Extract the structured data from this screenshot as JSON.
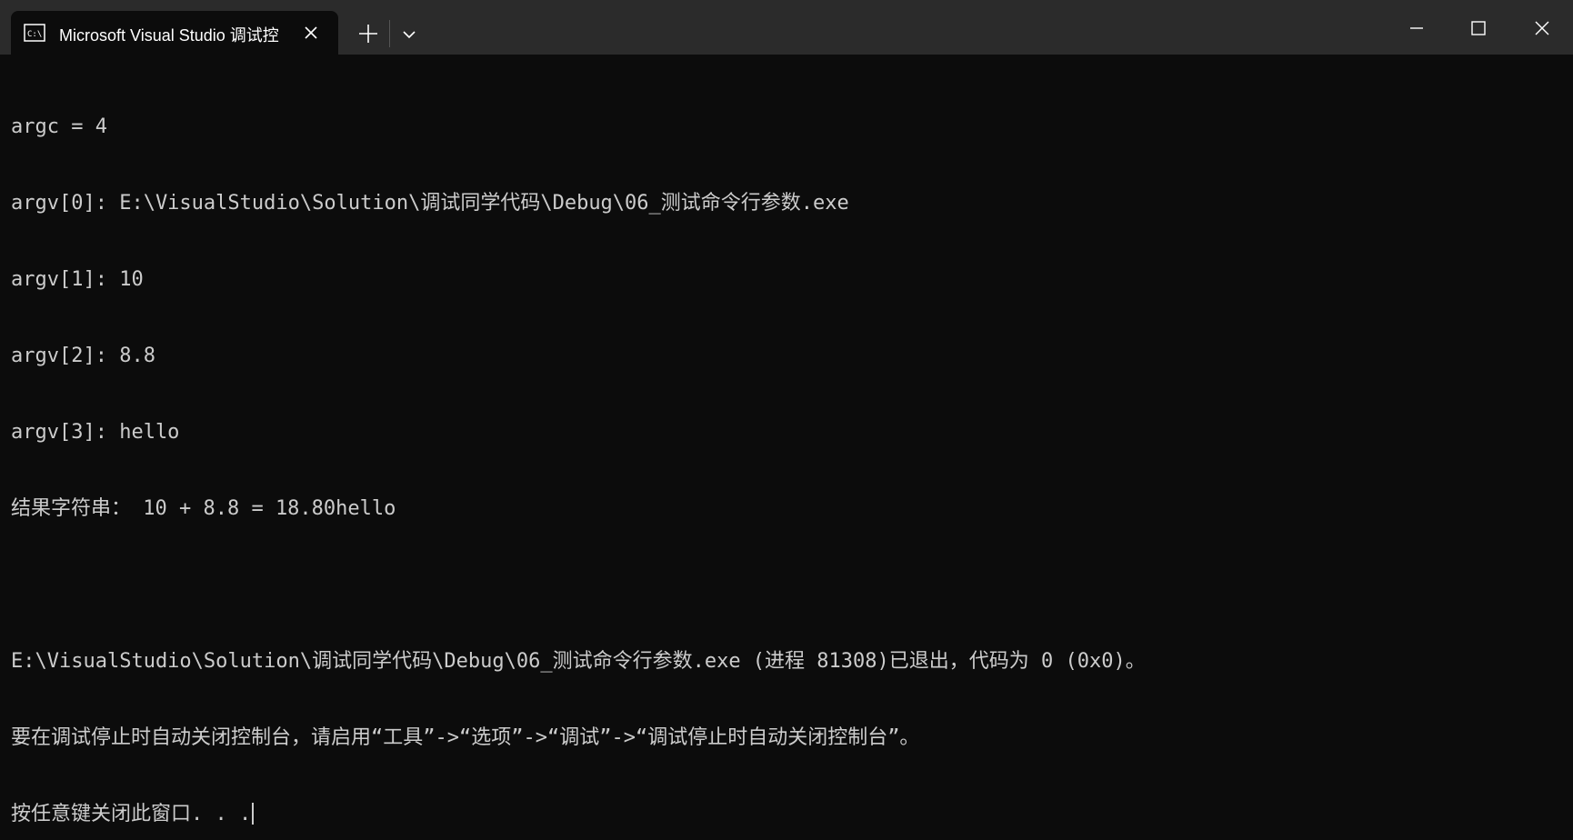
{
  "window": {
    "tab_title": "Microsoft Visual Studio 调试控",
    "tab_icon": "console-icon",
    "colors": {
      "titlebar": "#2b2b2b",
      "background": "#0c0c0c",
      "text": "#cccccc"
    }
  },
  "console": {
    "lines": [
      "argc = 4",
      "argv[0]: E:\\VisualStudio\\Solution\\调试同学代码\\Debug\\06_测试命令行参数.exe",
      "argv[1]: 10",
      "argv[2]: 8.8",
      "argv[3]: hello",
      "结果字符串： 10 + 8.8 = 18.80hello",
      "",
      "E:\\VisualStudio\\Solution\\调试同学代码\\Debug\\06_测试命令行参数.exe (进程 81308)已退出，代码为 0 (0x0)。",
      "要在调试停止时自动关闭控制台，请启用“工具”->“选项”->“调试”->“调试停止时自动关闭控制台”。",
      "按任意键关闭此窗口. . ."
    ]
  }
}
